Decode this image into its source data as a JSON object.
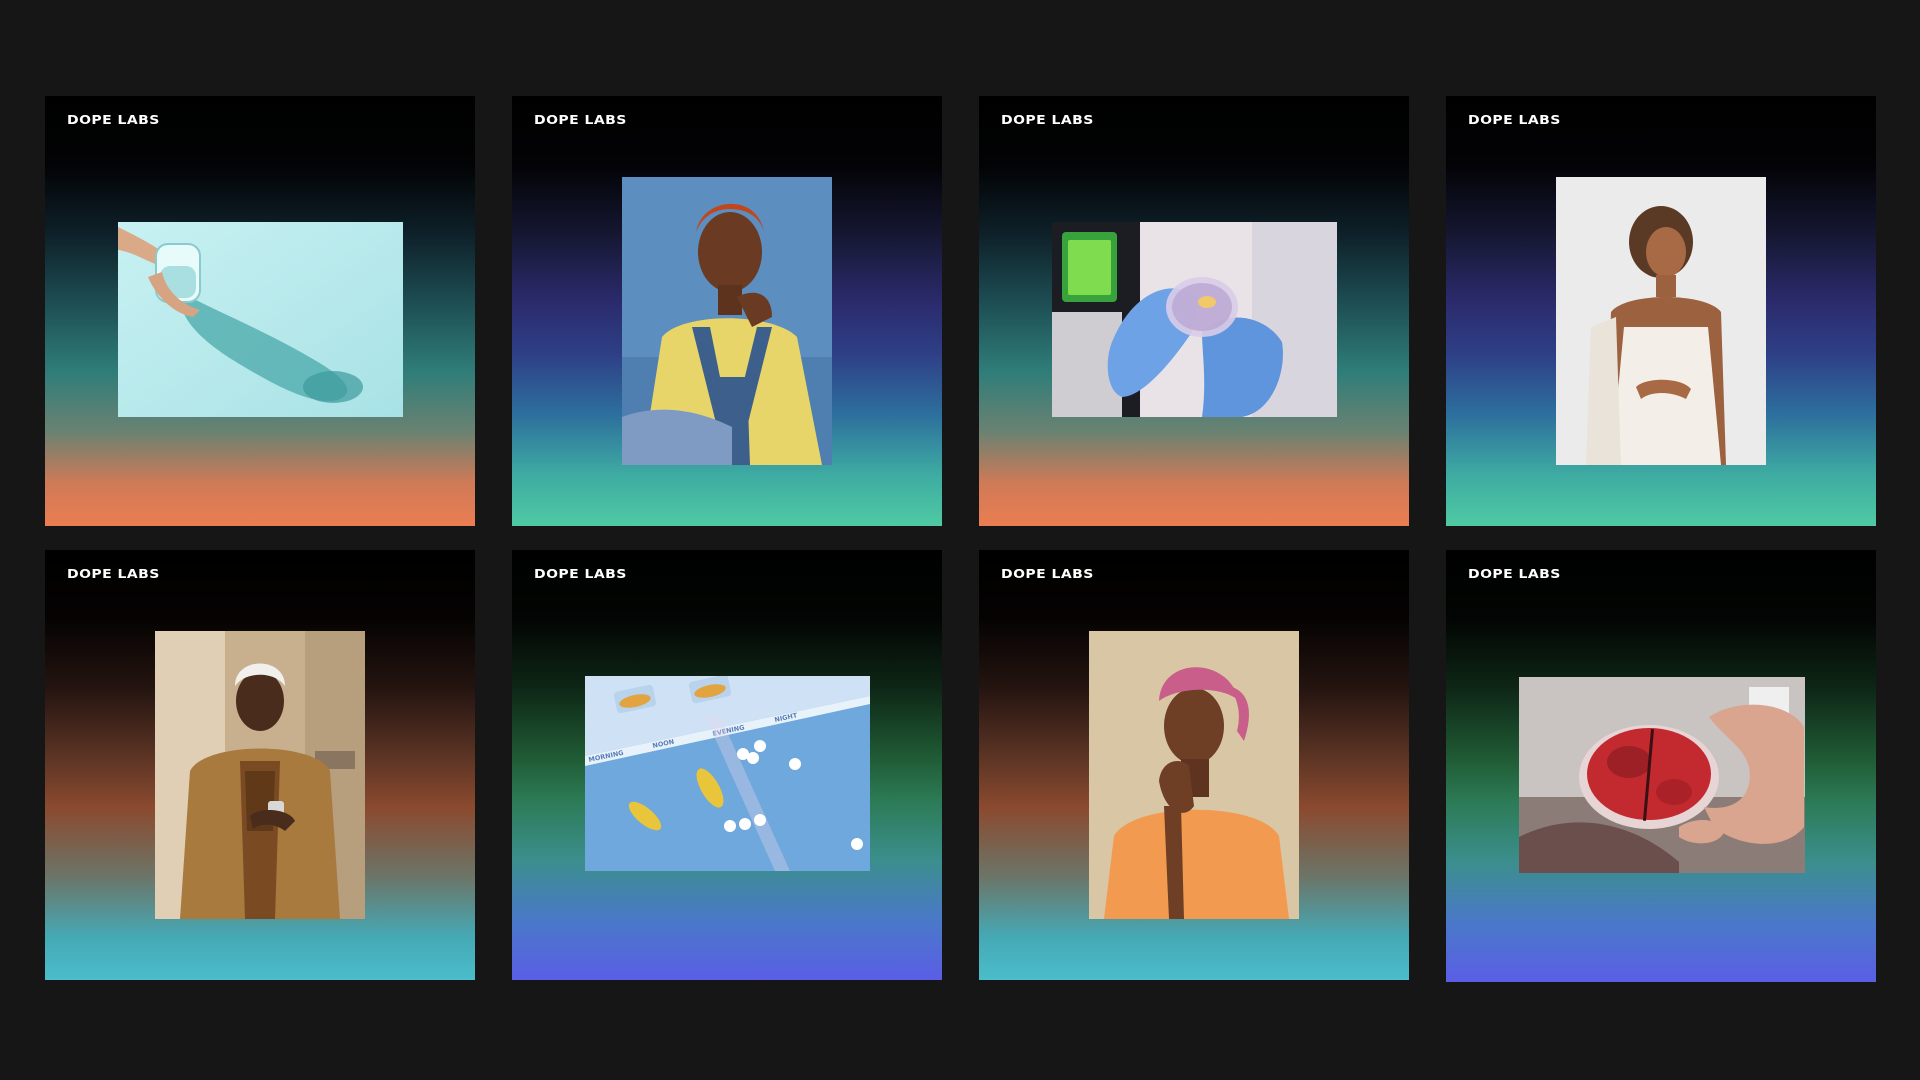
{
  "tiles": [
    {
      "brand": "DOPE LABS",
      "photo": "hand holding a glass of water casting shadow on light blue surface"
    },
    {
      "brand": "DOPE LABS",
      "photo": "woman with orange hair in overalls against blue wall"
    },
    {
      "brand": "DOPE LABS",
      "photo": "gloved hands holding a petri dish in a lab"
    },
    {
      "brand": "DOPE LABS",
      "photo": "woman in white slip dress holding a phone against white wall"
    },
    {
      "brand": "DOPE LABS",
      "photo": "woman with platinum hair in camel coat looking at phone"
    },
    {
      "brand": "DOPE LABS",
      "photo": "pill organizer with capsules and tablets on blue surface"
    },
    {
      "brand": "DOPE LABS",
      "photo": "person in pink cap and orange sweater"
    },
    {
      "brand": "DOPE LABS",
      "photo": "hand holding a red agar petri dish"
    }
  ],
  "pill_organizer_labels": [
    "MORNING",
    "NOON",
    "EVENING",
    "NIGHT"
  ],
  "colors": {
    "background": "#161616",
    "gradient_orange": "#ea7e52",
    "gradient_teal": "#4fcaa3",
    "gradient_cyan": "#4bbdcb",
    "gradient_indigo": "#5a5ee6"
  }
}
